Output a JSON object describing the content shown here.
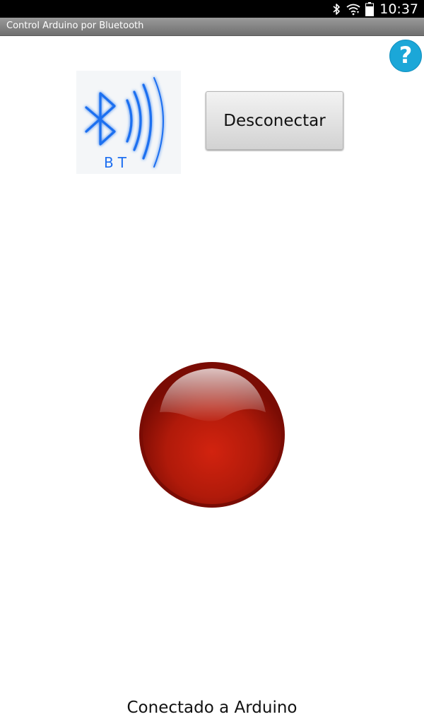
{
  "status_bar": {
    "time": "10:37",
    "icons": [
      "bluetooth-icon",
      "wifi-icon",
      "battery-icon"
    ]
  },
  "title_bar": {
    "title": "Control Arduino por Bluetooth"
  },
  "help_button": {
    "label": "?"
  },
  "bt_logo": {
    "text": "BT"
  },
  "disconnect_button": {
    "label": "Desconectar"
  },
  "led_button": {
    "color": "#c8150c"
  },
  "status_message": "Conectado a Arduino",
  "colors": {
    "help_accent": "#1ba7d8",
    "bluetooth_blue": "#1e6ff0",
    "led_red": "#c8150c"
  }
}
